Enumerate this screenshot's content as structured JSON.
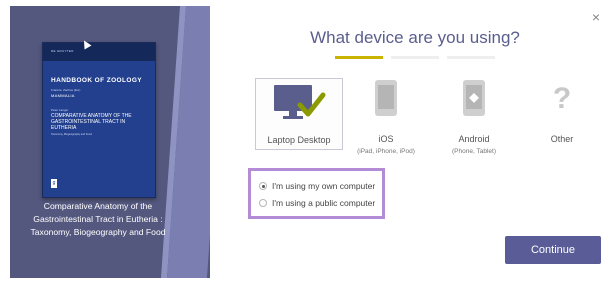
{
  "book": {
    "cover": {
      "publisher_mark": "DE GRUYTER",
      "series_title": "HANDBOOK OF ZOOLOGY",
      "editors": "Frank E. Zachos (Ed.)",
      "volume": "MAMMALIA",
      "author": "Peter Langer",
      "title": "COMPARATIVE ANATOMY OF THE GASTROINTESTINAL TRACT IN EUTHERIA",
      "subtitle": "Taxonomy, Biogeography and Food"
    },
    "caption": "Comparative Anatomy of the Gastrointestinal Tract in Eutheria : Taxonomy, Biogeography and Food"
  },
  "dialog": {
    "close_label": "×",
    "heading": "What device are you using?",
    "progress": {
      "total_steps": 3,
      "current_step": 1
    },
    "devices": [
      {
        "label": "Laptop Desktop",
        "sub": "",
        "icon": "laptop-check-icon",
        "selected": true
      },
      {
        "label": "iOS",
        "sub": "(iPad, iPhone, iPod)",
        "icon": "apple-icon",
        "selected": false
      },
      {
        "label": "Android",
        "sub": "(Phone, Tablet)",
        "icon": "android-icon",
        "selected": false
      },
      {
        "label": "Other",
        "sub": "",
        "icon": "question-icon",
        "selected": false
      }
    ],
    "computer_options": [
      {
        "label": "I'm using my own computer",
        "checked": true
      },
      {
        "label": "I'm using a public computer",
        "checked": false
      }
    ],
    "continue_label": "Continue"
  },
  "colors": {
    "accent": "#595c97",
    "progress_active": "#c9b500",
    "highlight_box": "#b48bd6",
    "check_mark": "#8a9a00",
    "monitor": "#5a5e8d"
  },
  "icons": {
    "apple_glyph": "",
    "android_glyph": "◆",
    "question_glyph": "?"
  }
}
